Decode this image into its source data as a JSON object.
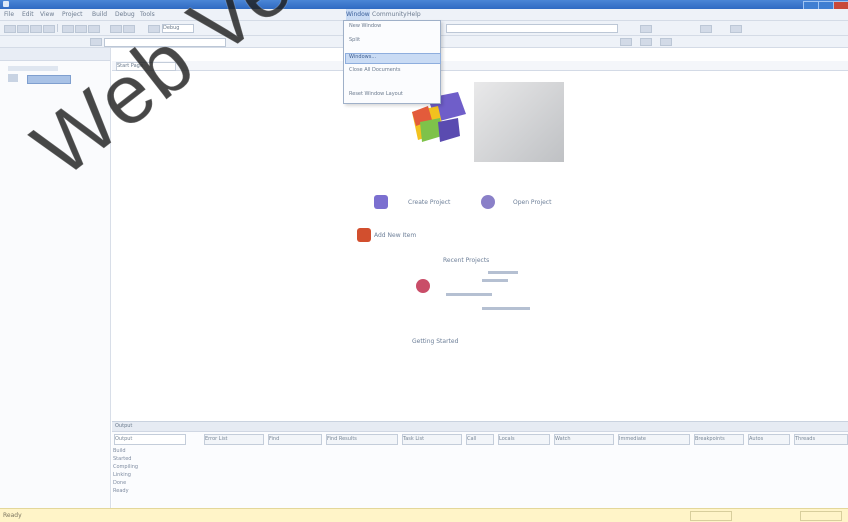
{
  "watermark": "Web Version",
  "menus": [
    "File",
    "Edit",
    "View",
    "Project",
    "Build",
    "Debug",
    "Tools",
    "Window",
    "Community",
    "Help"
  ],
  "dropdown_items": [
    "New Window",
    "Split",
    "Windows...",
    "Close All Documents",
    "Reset Window Layout"
  ],
  "toolbar_combo": "Debug",
  "doc_tab": "Start Page",
  "start_links": [
    "Create Project",
    "Open Project",
    "Add New Item",
    "Recent Projects",
    "Getting Started"
  ],
  "bottom_panel_title": "Output",
  "bottom_tabs": [
    "Output",
    "Error List",
    "Find",
    "Find Results",
    "Task List",
    "Call",
    "Locals",
    "Watch",
    "Immediate",
    "Breakpoints",
    "Autos",
    "Threads"
  ],
  "output_lines": [
    "Build",
    "Started",
    "Compiling",
    "Linking",
    "Done",
    "Ready"
  ],
  "status_text": "Ready",
  "colors": {
    "titlebar": "#2f6ac2",
    "status_bg": "#fff4c8",
    "highlight": "#c9dbf4"
  }
}
